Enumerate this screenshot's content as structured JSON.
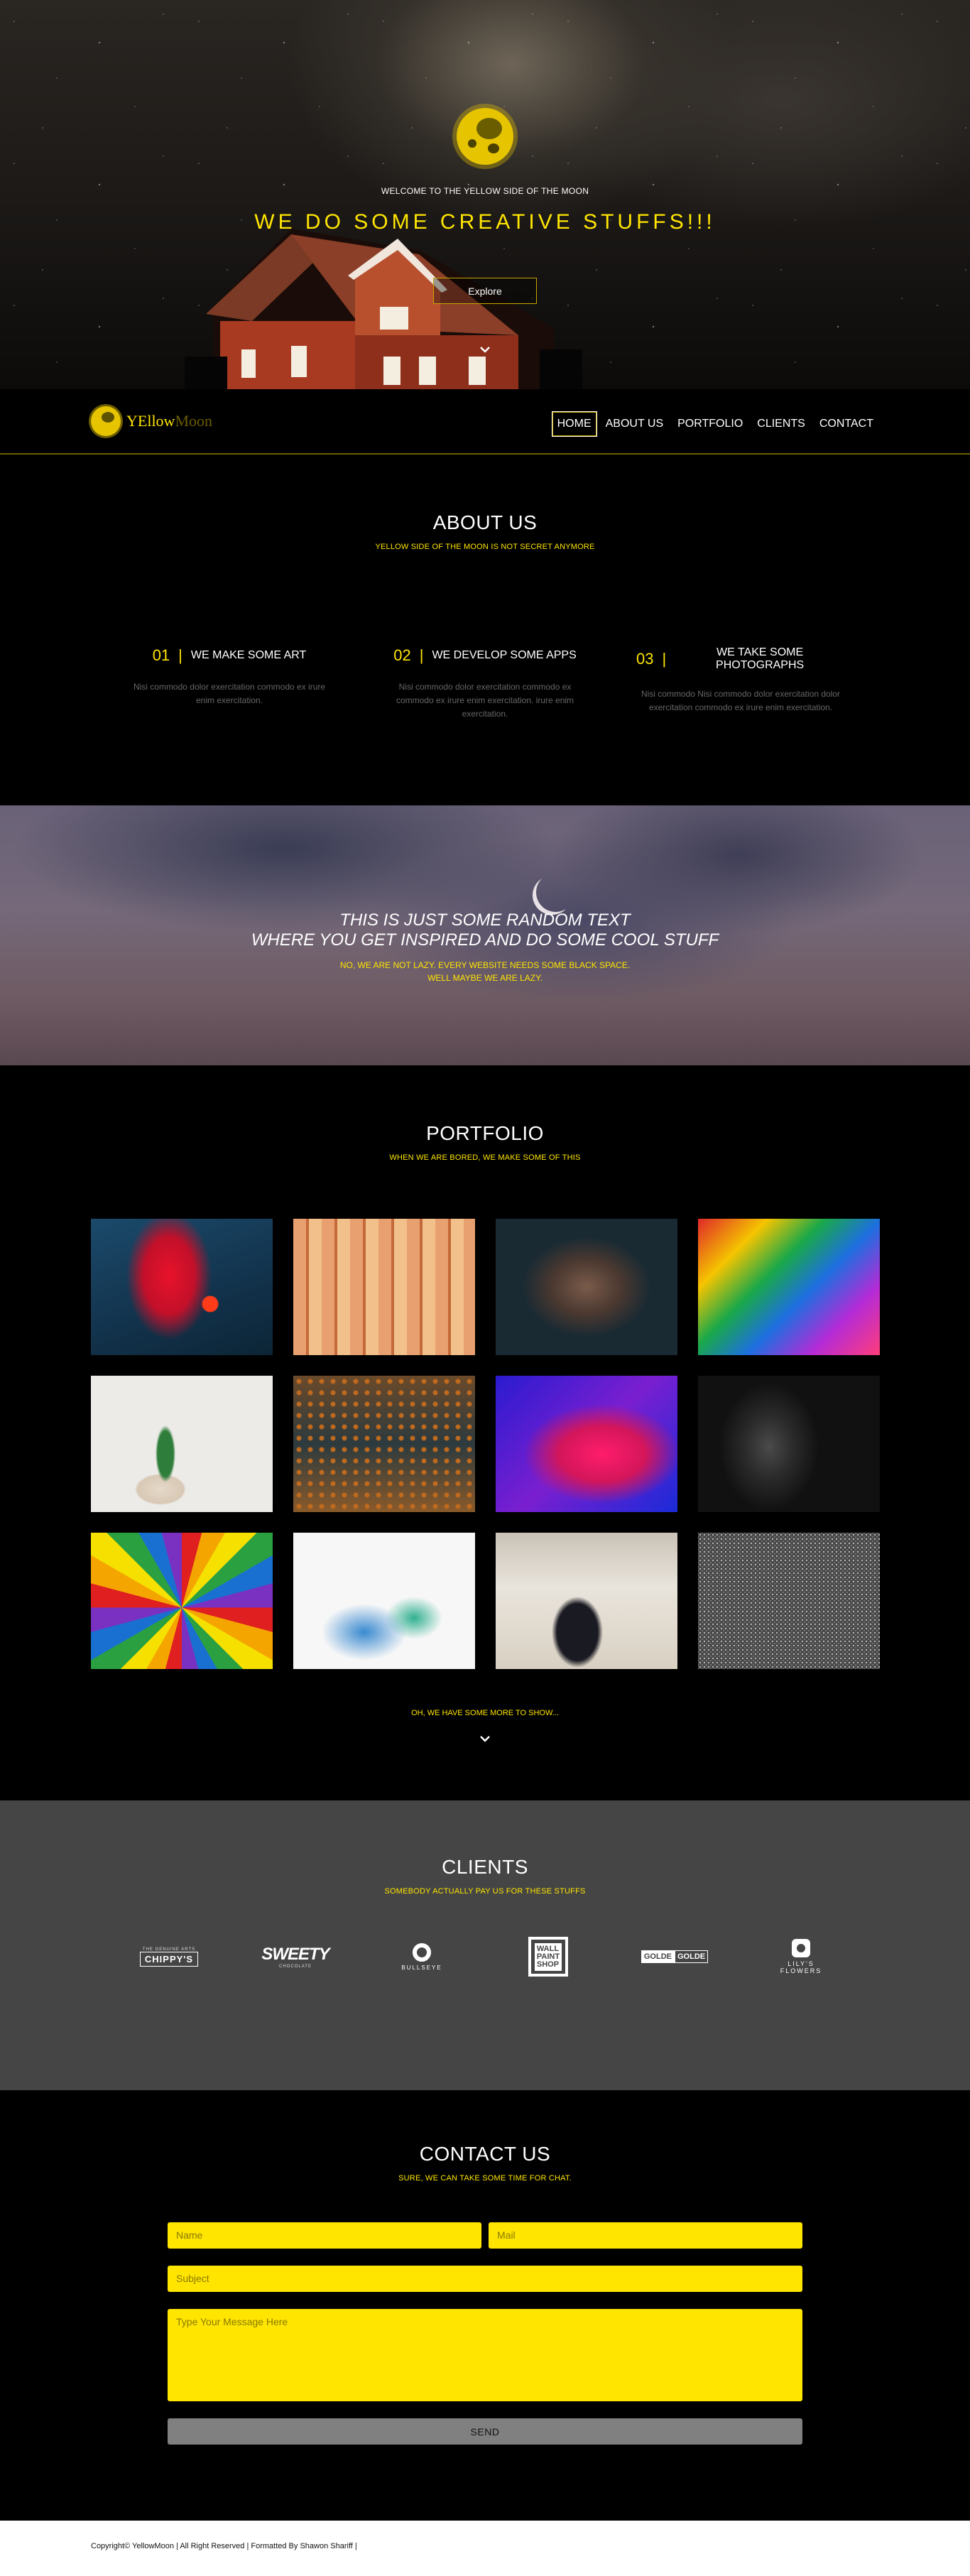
{
  "hero": {
    "welcome": "WELCOME TO THE YELLOW SIDE OF THE MOON",
    "headline": "WE DO SOME CREATIVE STUFFS!!!",
    "explore_label": "Explore"
  },
  "nav": {
    "brand_yellow": "YEllow",
    "brand_moon": "Moon",
    "items": [
      {
        "label": "HOME",
        "active": true
      },
      {
        "label": "ABOUT US",
        "active": false
      },
      {
        "label": "PORTFOLIO",
        "active": false
      },
      {
        "label": "CLIENTS",
        "active": false
      },
      {
        "label": "CONTACT",
        "active": false
      }
    ]
  },
  "about": {
    "title": "ABOUT US",
    "subtitle": "YELLOW SIDE OF THE MOON IS NOT SECRET ANYMORE",
    "features": [
      {
        "num": "01",
        "title": "WE MAKE SOME ART",
        "text": "Nisi commodo dolor exercitation commodo ex irure enim exercitation."
      },
      {
        "num": "02",
        "title": "WE DEVELOP SOME APPS",
        "text": "Nisi commodo dolor exercitation commodo ex commodo ex irure enim exercitation. irure enim exercitation."
      },
      {
        "num": "03",
        "title": "WE TAKE SOME PHOTOGRAPHS",
        "text": "Nisi commodo Nisi commodo dolor exercitation dolor exercitation commodo ex irure enim exercitation."
      }
    ]
  },
  "banner": {
    "line1": "THIS IS JUST SOME RANDOM TEXT",
    "line2": "WHERE YOU GET INSPIRED AND DO SOME COOL STUFF",
    "small1": "NO, WE ARE NOT LAZY. EVERY WEBSITE NEEDS SOME BLACK SPACE.",
    "small2": "WELL MAYBE WE ARE LAZY."
  },
  "portfolio": {
    "title": "PORTFOLIO",
    "subtitle": "WHEN WE ARE BORED, WE MAKE SOME OF THIS",
    "more": "OH, WE HAVE SOME MORE TO SHOW...",
    "tiles": [
      {
        "name": "red-paint-wall"
      },
      {
        "name": "painted-eye-wood"
      },
      {
        "name": "face-water-portrait"
      },
      {
        "name": "rainbow-painted-face"
      },
      {
        "name": "green-sprout-hand"
      },
      {
        "name": "bead-curtain"
      },
      {
        "name": "pink-blue-paint"
      },
      {
        "name": "dark-painted-face"
      },
      {
        "name": "colored-pencils-circle"
      },
      {
        "name": "pencil-shavings"
      },
      {
        "name": "artist-at-desk"
      },
      {
        "name": "smiley-in-sand"
      }
    ]
  },
  "clients": {
    "title": "CLIENTS",
    "subtitle": "SOMEBODY ACTUALLY PAY US FOR THESE STUFFS",
    "logos": {
      "chippys_small": "THE GENUINE ARTS",
      "chippys": "CHIPPY'S",
      "sweety": "SWEETY",
      "sweety_small": "CHOCOLATE",
      "bullseye": "BULLSEYE",
      "wall1": "WALL",
      "wall2": "PAINT",
      "wall3": "SHOP",
      "golde_a": "GOLDE",
      "golde_b": "GOLDE",
      "lily1": "LILY'S",
      "lily2": "FLOWERS"
    }
  },
  "contact": {
    "title": "CONTACT US",
    "subtitle": "SURE, WE CAN TAKE SOME TIME FOR CHAT.",
    "name_placeholder": "Name",
    "mail_placeholder": "Mail",
    "subject_placeholder": "Subject",
    "message_placeholder": "Type Your Message Here",
    "send_label": "SEND"
  },
  "footer": {
    "text": "Copyright© YellowMoon | All Right Reserved | Formatted By Shawon Shariff |"
  },
  "colors": {
    "accent": "#ffe500",
    "clients_bg": "#454545"
  }
}
